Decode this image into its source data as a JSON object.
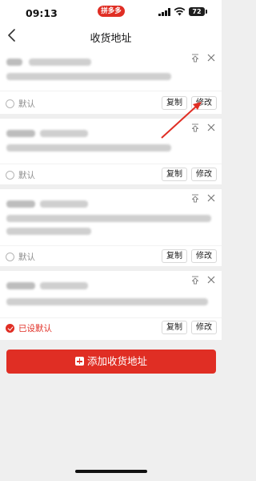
{
  "status_bar": {
    "time": "09:13",
    "app_badge": "拼多多",
    "battery": "72",
    "icons": [
      "signal-icon",
      "wifi-icon",
      "battery-icon"
    ]
  },
  "nav": {
    "title": "收货地址",
    "back_icon": "chevron-left-icon"
  },
  "addresses": [
    {
      "default_label": "默认",
      "copy_label": "复制",
      "edit_label": "修改",
      "is_default": false
    },
    {
      "default_label": "默认",
      "copy_label": "复制",
      "edit_label": "修改",
      "is_default": false
    },
    {
      "default_label": "默认",
      "copy_label": "复制",
      "edit_label": "修改",
      "is_default": false
    },
    {
      "default_label": "已设默认",
      "copy_label": "复制",
      "edit_label": "修改",
      "is_default": true
    }
  ],
  "add_button": {
    "label": "添加收货地址"
  },
  "colors": {
    "accent": "#e02e24",
    "background": "#efefef"
  }
}
